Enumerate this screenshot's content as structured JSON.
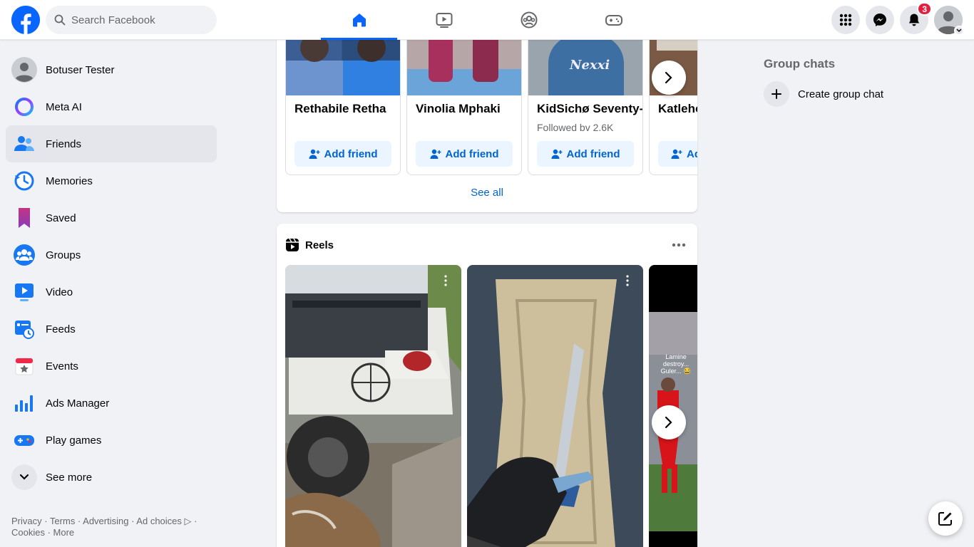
{
  "header": {
    "search_placeholder": "Search Facebook",
    "notifications_count": "3",
    "nav_tabs": [
      "home-icon",
      "watch-icon",
      "groups-icon",
      "gaming-icon"
    ]
  },
  "sidebar": {
    "items": [
      {
        "label": "Botuser Tester",
        "icon": "profile-avatar"
      },
      {
        "label": "Meta AI",
        "icon": "meta-ai-icon"
      },
      {
        "label": "Friends",
        "icon": "friends-icon"
      },
      {
        "label": "Memories",
        "icon": "memories-icon"
      },
      {
        "label": "Saved",
        "icon": "saved-icon"
      },
      {
        "label": "Groups",
        "icon": "groups-icon"
      },
      {
        "label": "Video",
        "icon": "video-icon"
      },
      {
        "label": "Feeds",
        "icon": "feeds-icon"
      },
      {
        "label": "Events",
        "icon": "events-icon"
      },
      {
        "label": "Ads Manager",
        "icon": "ads-manager-icon"
      },
      {
        "label": "Play games",
        "icon": "play-games-icon"
      },
      {
        "label": "See more",
        "icon": "chevron-down-icon"
      }
    ],
    "footer": {
      "line1": "Privacy · Terms · Advertising · Ad choices",
      "line2": "Cookies · More"
    }
  },
  "people_you_may_know": {
    "people": [
      {
        "name": "Rethabile Retha",
        "subtitle": "",
        "button": "Add friend"
      },
      {
        "name": "Vinolia Mphaki",
        "subtitle": "",
        "button": "Add friend"
      },
      {
        "name": "KidSichø Seventy-",
        "subtitle": "Followed bv 2.6K",
        "button": "Add friend"
      },
      {
        "name": "Katleho",
        "subtitle": "",
        "button": "Add friend"
      }
    ],
    "see_all": "See all"
  },
  "reels": {
    "title": "Reels",
    "third_reel_caption": "Lamine destroy... Guler... 😂"
  },
  "right_column": {
    "title": "Group chats",
    "create_label": "Create group chat"
  },
  "colors": {
    "brand": "#0866ff",
    "link": "#0064d1",
    "badge": "#e41e3f"
  }
}
